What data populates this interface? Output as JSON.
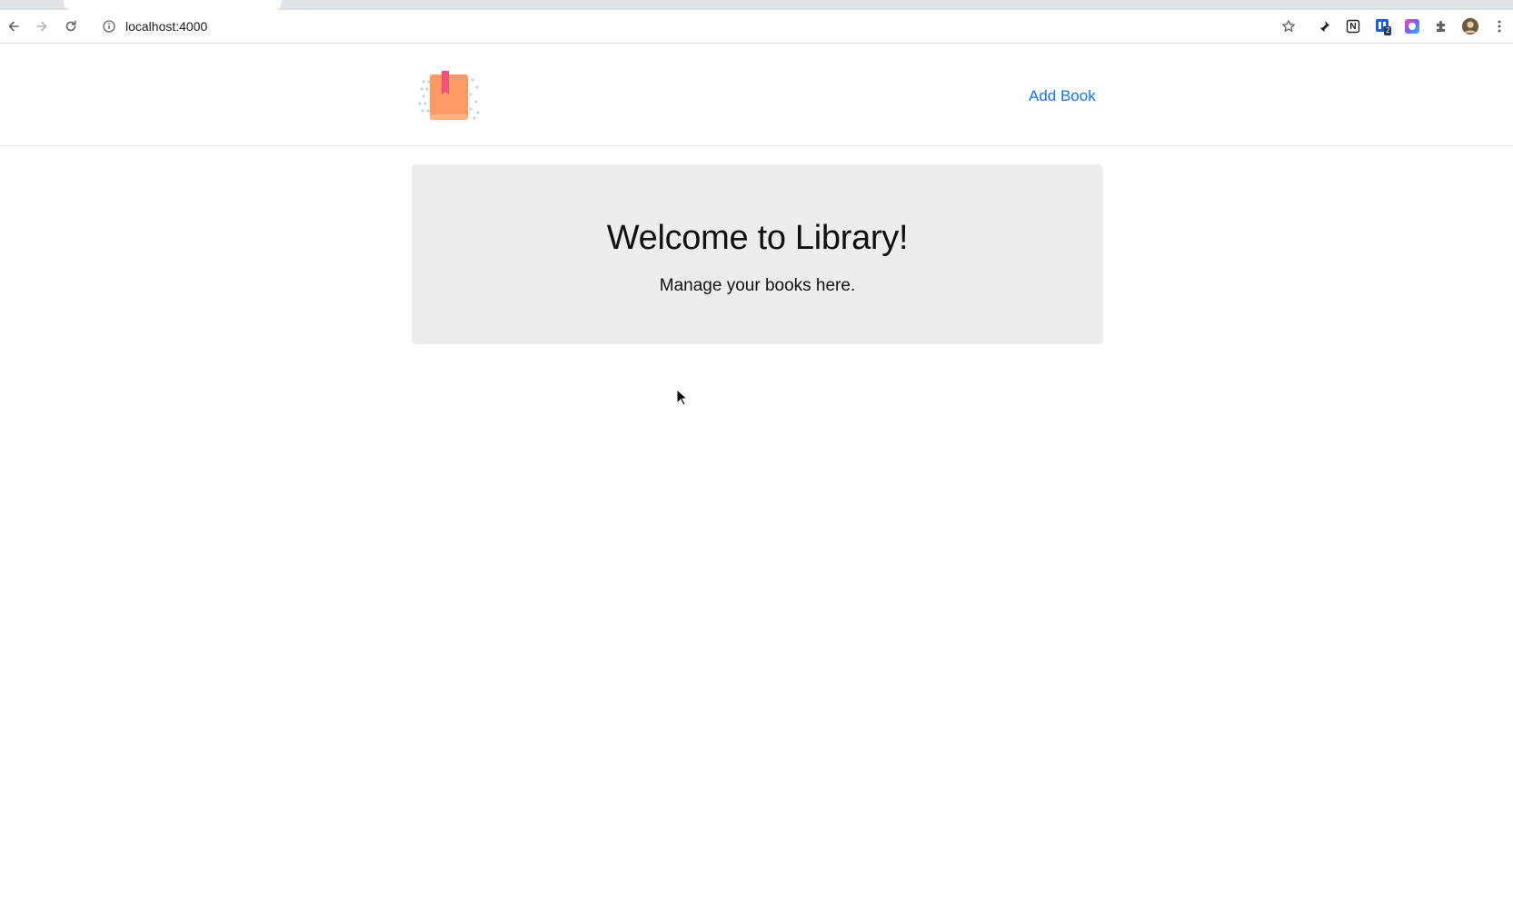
{
  "browser": {
    "url": "localhost:4000",
    "icons": [
      "back-icon",
      "forward-icon",
      "reload-icon",
      "info-icon",
      "bookmark-star-icon",
      "pin-extension-icon",
      "notion-extension-icon",
      "trello-extension-icon",
      "color-extension-icon",
      "extensions-puzzle-icon",
      "profile-avatar",
      "menu-dots-icon"
    ],
    "trello_badge": "2",
    "notion_letter": "N"
  },
  "header": {
    "add_book_label": "Add Book"
  },
  "hero": {
    "title": "Welcome to Library!",
    "subtitle": "Manage your books here."
  },
  "colors": {
    "link": "#1a73e8",
    "hero_bg": "#ededed",
    "logo_book": "#ff9966",
    "logo_bookmark": "#f0507a"
  }
}
